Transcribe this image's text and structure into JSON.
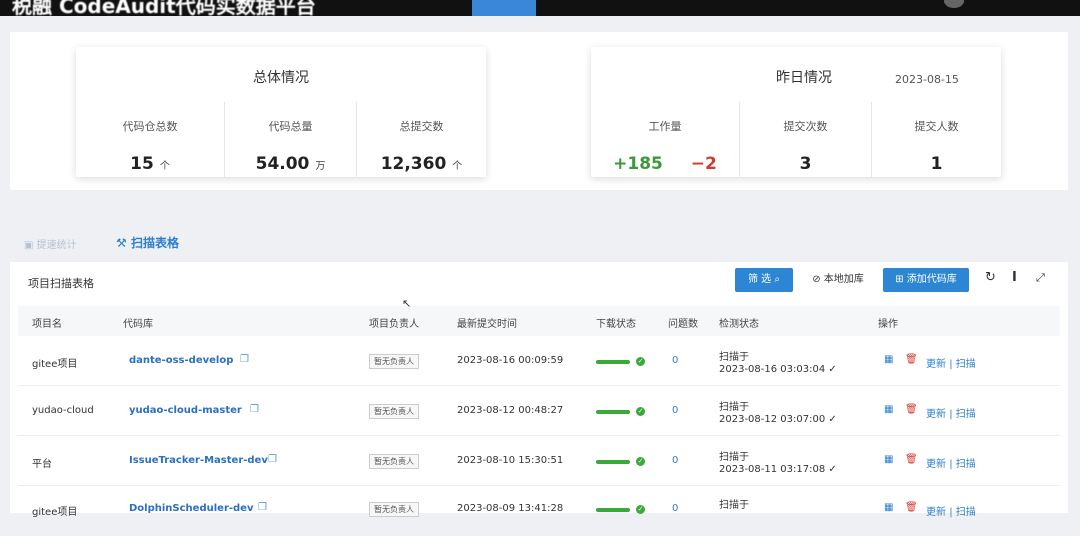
{
  "app": {
    "title": "税融 CodeAudit代码实数据平台"
  },
  "overall": {
    "title": "总体情况",
    "metrics": [
      {
        "label": "代码仓总数",
        "value": "15",
        "unit": "个"
      },
      {
        "label": "代码总量",
        "value": "54.00",
        "unit": "万"
      },
      {
        "label": "总提交数",
        "value": "12,360",
        "unit": "个"
      }
    ]
  },
  "yesterday": {
    "title": "昨日情况",
    "date": "2023-08-15",
    "workload": {
      "label": "工作量",
      "added": "+185",
      "removed": "−2"
    },
    "commits": {
      "label": "提交次数",
      "value": "3"
    },
    "committers": {
      "label": "提交人数",
      "value": "1"
    }
  },
  "tabs": {
    "tab1": "提速统计",
    "tab2": "扫描表格"
  },
  "table": {
    "title": "项目扫描表格",
    "buttons": {
      "filter": "筛 选",
      "local_add": "本地加库",
      "add_repo": "添加代码库"
    },
    "columns": [
      "项目名",
      "代码库",
      "项目负责人",
      "最新提交时间",
      "下载状态",
      "问题数",
      "检测状态",
      "操作"
    ],
    "rows": [
      {
        "project": "gitee项目",
        "repo": "dante-oss-develop",
        "owner": "暂无负责人",
        "last_commit": "2023-08-16 00:09:59",
        "issues": "0",
        "scan_label": "扫描于",
        "scan_time": "2023-08-16 03:03:04"
      },
      {
        "project": "yudao-cloud",
        "repo": "yudao-cloud-master",
        "owner": "暂无负责人",
        "last_commit": "2023-08-12 00:48:27",
        "issues": "0",
        "scan_label": "扫描于",
        "scan_time": "2023-08-12 03:07:00"
      },
      {
        "project": "平台",
        "repo": "IssueTracker-Master-dev",
        "owner": "暂无负责人",
        "last_commit": "2023-08-10 15:30:51",
        "issues": "0",
        "scan_label": "扫描于",
        "scan_time": "2023-08-11 03:17:08"
      },
      {
        "project": "gitee项目",
        "repo": "DolphinScheduler-dev",
        "owner": "暂无负责人",
        "last_commit": "2023-08-09 13:41:28",
        "issues": "0",
        "scan_label": "扫描于",
        "scan_time": ""
      }
    ],
    "ops": {
      "update": "更新",
      "divider": "|",
      "scan": "扫描"
    }
  },
  "icons": {
    "check": "✓",
    "copy": "❐",
    "view": "▦",
    "delete": "🗑",
    "refresh": "↻",
    "density": "I",
    "fullscreen": "⤢"
  }
}
